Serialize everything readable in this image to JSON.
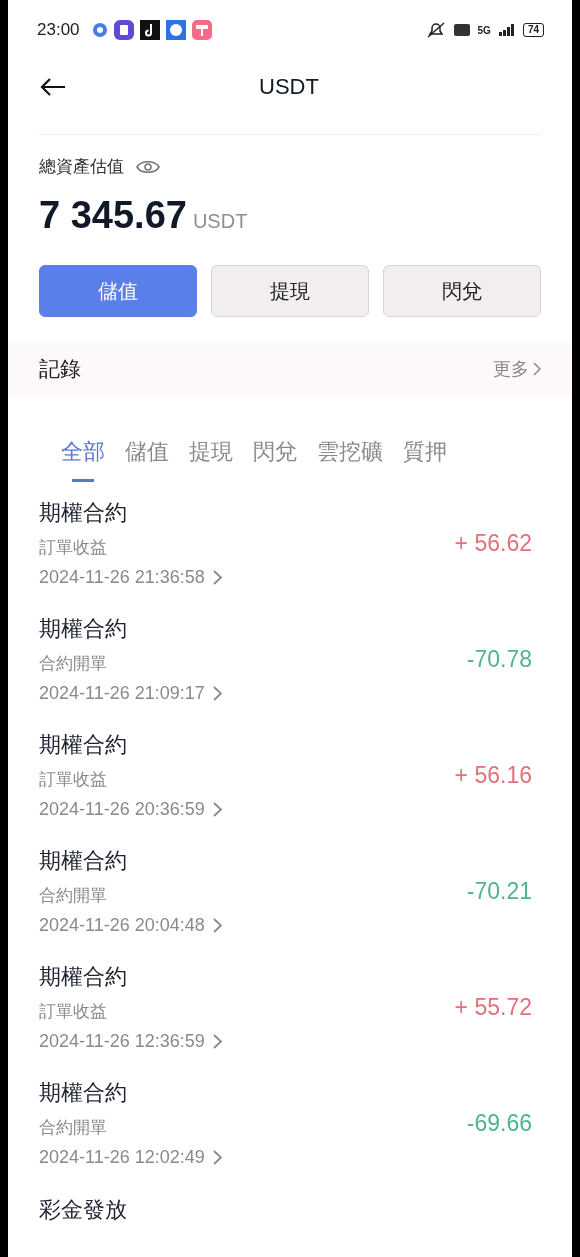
{
  "status_bar": {
    "time": "23:00",
    "network": "5G",
    "battery": "74"
  },
  "header": {
    "title": "USDT"
  },
  "balance": {
    "label": "總資產估值",
    "amount": "7 345.67",
    "unit": "USDT"
  },
  "actions": [
    {
      "label": "儲值",
      "primary": true
    },
    {
      "label": "提現",
      "primary": false
    },
    {
      "label": "閃兌",
      "primary": false
    }
  ],
  "records": {
    "title": "記錄",
    "more": "更多"
  },
  "tabs": [
    {
      "label": "全部",
      "selected": true
    },
    {
      "label": "儲值",
      "selected": false
    },
    {
      "label": "提現",
      "selected": false
    },
    {
      "label": "閃兌",
      "selected": false
    },
    {
      "label": "雲挖礦",
      "selected": false
    },
    {
      "label": "質押",
      "selected": false
    }
  ],
  "transactions": [
    {
      "title": "期權合約",
      "type": "訂單收益",
      "time": "2024-11-26 21:36:58",
      "amount": "+ 56.62",
      "kind": "credit"
    },
    {
      "title": "期權合約",
      "type": "合約開單",
      "time": "2024-11-26 21:09:17",
      "amount": "-70.78",
      "kind": "debit"
    },
    {
      "title": "期權合約",
      "type": "訂單收益",
      "time": "2024-11-26 20:36:59",
      "amount": "+ 56.16",
      "kind": "credit"
    },
    {
      "title": "期權合約",
      "type": "合約開單",
      "time": "2024-11-26 20:04:48",
      "amount": "-70.21",
      "kind": "debit"
    },
    {
      "title": "期權合約",
      "type": "訂單收益",
      "time": "2024-11-26 12:36:59",
      "amount": "+ 55.72",
      "kind": "credit"
    },
    {
      "title": "期權合約",
      "type": "合約開單",
      "time": "2024-11-26 12:02:49",
      "amount": "-69.66",
      "kind": "debit"
    },
    {
      "title": "彩金發放"
    }
  ]
}
